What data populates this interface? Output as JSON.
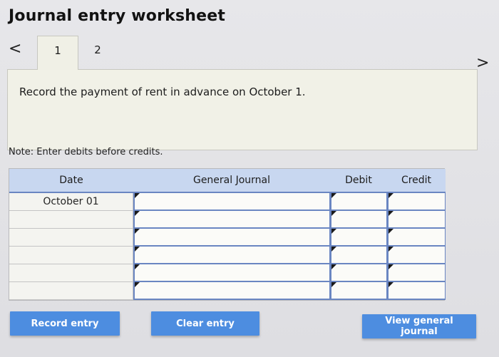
{
  "header": {
    "title": "Journal entry worksheet"
  },
  "navigation": {
    "prev_glyph": "<",
    "next_glyph": ">",
    "tabs": [
      {
        "label": "1",
        "active": true
      },
      {
        "label": "2",
        "active": false
      }
    ]
  },
  "instruction": {
    "text": "Record the payment of rent in advance on October 1."
  },
  "note": {
    "text": "Note: Enter debits before credits."
  },
  "table": {
    "columns": {
      "date": "Date",
      "general_journal": "General Journal",
      "debit": "Debit",
      "credit": "Credit"
    },
    "rows": [
      {
        "date": "October 01",
        "account": "",
        "debit": "",
        "credit": ""
      },
      {
        "date": "",
        "account": "",
        "debit": "",
        "credit": ""
      },
      {
        "date": "",
        "account": "",
        "debit": "",
        "credit": ""
      },
      {
        "date": "",
        "account": "",
        "debit": "",
        "credit": ""
      },
      {
        "date": "",
        "account": "",
        "debit": "",
        "credit": ""
      },
      {
        "date": "",
        "account": "",
        "debit": "",
        "credit": ""
      }
    ]
  },
  "buttons": {
    "record": "Record entry",
    "clear": "Clear entry",
    "view": "View general journal"
  },
  "colors": {
    "button_blue": "#4d8de0",
    "header_blue": "#c8d7f0",
    "grid_blue": "#6a86c2",
    "panel_bg": "#f1f1e7"
  }
}
